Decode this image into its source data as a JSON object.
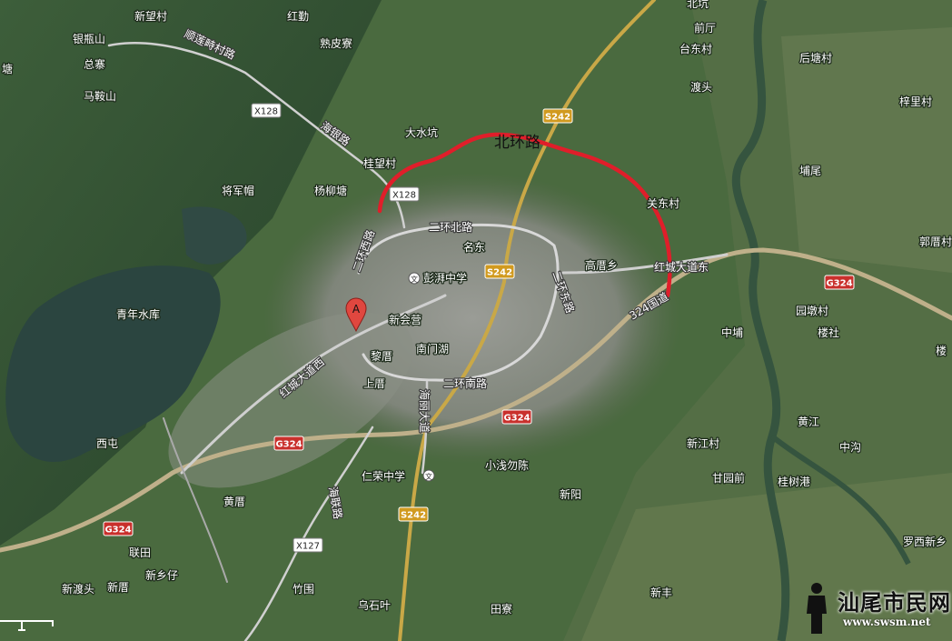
{
  "ring_road_label": "北环路",
  "marker": {
    "letter": "A"
  },
  "watermark": {
    "text": "汕尾市民网",
    "url": "www.swsm.net"
  },
  "route_color": "#e01e2a",
  "shields": [
    {
      "id": "x128-a",
      "kind": "x",
      "text": "X128"
    },
    {
      "id": "x128-b",
      "kind": "x",
      "text": "X128"
    },
    {
      "id": "x127",
      "kind": "x",
      "text": "X127"
    },
    {
      "id": "s242-a",
      "kind": "s",
      "text": "S242"
    },
    {
      "id": "s242-b",
      "kind": "s",
      "text": "S242"
    },
    {
      "id": "s242-c",
      "kind": "s",
      "text": "S242"
    },
    {
      "id": "g324-a",
      "kind": "g",
      "text": "G324"
    },
    {
      "id": "g324-b",
      "kind": "g",
      "text": "G324"
    },
    {
      "id": "g324-c",
      "kind": "g",
      "text": "G324"
    },
    {
      "id": "g324-d",
      "kind": "g",
      "text": "G324"
    }
  ],
  "places": [
    {
      "id": "xinwangcun",
      "text": "新望村"
    },
    {
      "id": "yinpingshan",
      "text": "银瓶山"
    },
    {
      "id": "zongzhai",
      "text": "总寨"
    },
    {
      "id": "maanshan",
      "text": "马鞍山"
    },
    {
      "id": "hongqin",
      "text": "红勤"
    },
    {
      "id": "shupizhai",
      "text": "熟皮寮"
    },
    {
      "id": "beikeng",
      "text": "北坑"
    },
    {
      "id": "qianting",
      "text": "前厅"
    },
    {
      "id": "taidongcun",
      "text": "台东村"
    },
    {
      "id": "houtangcun",
      "text": "后塘村"
    },
    {
      "id": "dutou",
      "text": "渡头"
    },
    {
      "id": "zilicun",
      "text": "梓里村"
    },
    {
      "id": "dashuikeng",
      "text": "大水坑"
    },
    {
      "id": "guiwangcun",
      "text": "桂望村"
    },
    {
      "id": "jiangjunmao",
      "text": "将军帽"
    },
    {
      "id": "yangliutang",
      "text": "杨柳塘"
    },
    {
      "id": "tangwei",
      "text": "埔尾"
    },
    {
      "id": "guandongcun",
      "text": "关东村"
    },
    {
      "id": "guoxiacun",
      "text": "郭厝村"
    },
    {
      "id": "mingdong",
      "text": "名东"
    },
    {
      "id": "pengpaizhongxue",
      "text": "彭湃中学"
    },
    {
      "id": "gaocuoxiang",
      "text": "高厝乡"
    },
    {
      "id": "qingnianshuiku",
      "text": "青年水库"
    },
    {
      "id": "xinhuiying",
      "text": "新会营"
    },
    {
      "id": "nanmenhu",
      "text": "南门湖"
    },
    {
      "id": "licuo",
      "text": "黎厝"
    },
    {
      "id": "shangcuo",
      "text": "上厝"
    },
    {
      "id": "yuandunchun",
      "text": "园墩村"
    },
    {
      "id": "loushe",
      "text": "楼社"
    },
    {
      "id": "zhongpu",
      "text": "中埔"
    },
    {
      "id": "louer",
      "text": "楼"
    },
    {
      "id": "huangjiang",
      "text": "黄江"
    },
    {
      "id": "zhonggou",
      "text": "中沟"
    },
    {
      "id": "xitun",
      "text": "西屯"
    },
    {
      "id": "xinjiangcun",
      "text": "新江村"
    },
    {
      "id": "ganyuanqian",
      "text": "甘园前"
    },
    {
      "id": "guishugang",
      "text": "桂树港"
    },
    {
      "id": "xiaoqianwuchen",
      "text": "小浅勿陈"
    },
    {
      "id": "renrongzhongxue",
      "text": "仁荣中学"
    },
    {
      "id": "huangcuo",
      "text": "黄厝"
    },
    {
      "id": "xinyang",
      "text": "新阳"
    },
    {
      "id": "luoxixinxiang",
      "text": "罗西新乡"
    },
    {
      "id": "liantian",
      "text": "联田"
    },
    {
      "id": "xinxiangzi",
      "text": "新乡仔"
    },
    {
      "id": "xindutou",
      "text": "新渡头"
    },
    {
      "id": "xincuo",
      "text": "新厝"
    },
    {
      "id": "zhuwei",
      "text": "竹围"
    },
    {
      "id": "xinfeng",
      "text": "新丰"
    },
    {
      "id": "wushiye",
      "text": "乌石叶"
    },
    {
      "id": "tianliao",
      "text": "田寮"
    },
    {
      "id": "tanglan",
      "text": "塘"
    }
  ],
  "roads": [
    {
      "id": "shunlianqi",
      "text": "顺莲畤村路"
    },
    {
      "id": "haiyinlu",
      "text": "海银路"
    },
    {
      "id": "erhuanbeilu",
      "text": "二环北路"
    },
    {
      "id": "erhuanxilu",
      "text": "二环西路"
    },
    {
      "id": "erhuandonglu",
      "text": "二环东路"
    },
    {
      "id": "erhuannanlu",
      "text": "二环南路"
    },
    {
      "id": "hongchengdadaodong",
      "text": "红城大道东"
    },
    {
      "id": "hongchengdadaoxi",
      "text": "红城大道西"
    },
    {
      "id": "guodao324",
      "text": "324国道"
    },
    {
      "id": "hailidadao",
      "text": "海丽大道"
    },
    {
      "id": "hailianlu",
      "text": "海联路"
    }
  ],
  "school_icon": "文"
}
